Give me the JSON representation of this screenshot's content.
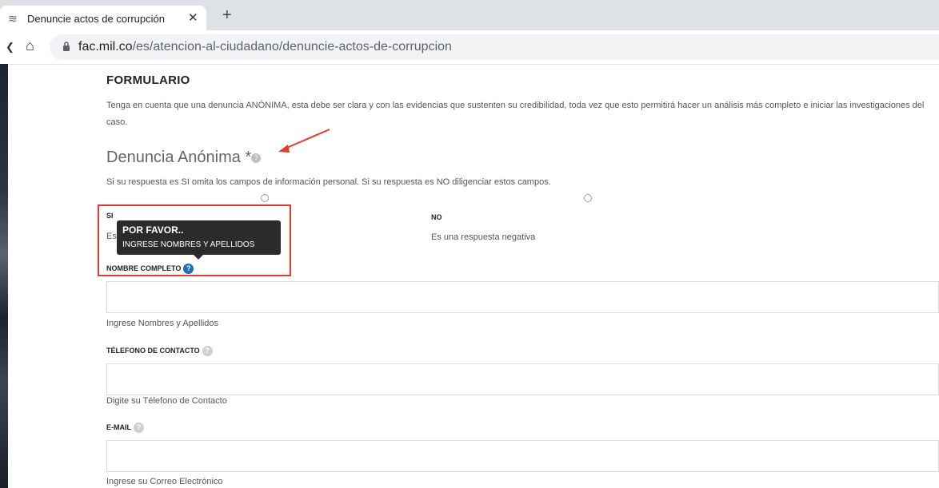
{
  "browser": {
    "tab_title": "Denuncie actos de corrupción",
    "tab_close": "✕",
    "new_tab": "+",
    "url_domain": "fac.mil.co",
    "url_path": "/es/atencion-al-ciudadano/denuncie-actos-de-corrupcion"
  },
  "form": {
    "title": "FORMULARIO",
    "intro": "Tenga en cuenta que una denuncia ANÓNIMA, esta debe ser clara y con las evidencias que sustenten su credibilidad, toda vez que esto permitirá hacer un análisis más completo e iniciar las investigaciones del caso.",
    "question_title": "Denuncia Anónima *",
    "question_desc": "Si su respuesta es SI omita los campos de información personal. Si su respuesta es NO diligenciar estos campos.",
    "option_si_label": "SI",
    "option_si_desc_prefix": "Es",
    "option_no_label": "NO",
    "option_no_desc": "Es una respuesta negativa",
    "fields": [
      {
        "label": "NOMBRE COMPLETO",
        "help": "Ingrese Nombres y Apellidos"
      },
      {
        "label": "TÉLEFONO DE CONTACTO",
        "help": "Digite su Télefono de Contacto"
      },
      {
        "label": "E-MAIL",
        "help": "Ingrese su Correo Electrónico"
      }
    ]
  },
  "tooltip": {
    "title": "POR FAVOR..",
    "body": "INGRESE NOMBRES Y APELLIDOS"
  },
  "colors": {
    "annotation": "#e53b2c",
    "help_blue": "#1f6fb5"
  }
}
